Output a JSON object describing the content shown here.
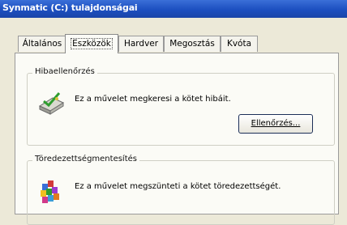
{
  "window": {
    "title": "Synmatic (C:) tulajdonságai"
  },
  "tabs": [
    {
      "label": "Általános"
    },
    {
      "label": "Eszközök"
    },
    {
      "label": "Hardver"
    },
    {
      "label": "Megosztás"
    },
    {
      "label": "Kvóta"
    }
  ],
  "active_tab": "Eszközök",
  "groups": {
    "error_check": {
      "title": "Hibaellenőrzés",
      "text": "Ez a művelet megkeresi a kötet hibáit.",
      "button_label": "Ellenőrzés...",
      "icon": "disk-check-icon"
    },
    "defrag": {
      "title": "Töredezettségmentesítés",
      "text": "Ez a művelet megszünteti a kötet töredezettségét.",
      "icon": "defrag-icon"
    }
  },
  "colors": {
    "titlebar": "#1c4fc0",
    "dialog_bg": "#ece9d8",
    "panel_bg": "#fbfbf6"
  }
}
